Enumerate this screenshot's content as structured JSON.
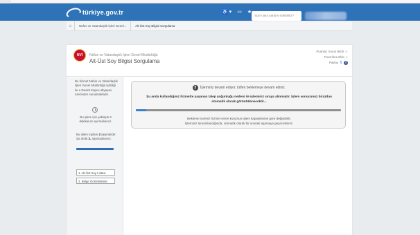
{
  "header": {
    "logo_text": "türkiye.gov.tr",
    "accessibility_label": "♿ ▾",
    "icons": [
      "accessibility-icon",
      "id-card-icon",
      "star-icon"
    ],
    "search_placeholder": "Size nasıl yardım edebiliriz?",
    "brand_color": "#2e72b8"
  },
  "breadcrumb": {
    "items": [
      "Nüfus ve Vatandaşlık İşleri Genel...",
      "Alt-Üst Soy Bilgisi Sorgulama"
    ]
  },
  "service": {
    "logo_text": "NVİ",
    "org": "Nüfus ve Vatandaşlık İşleri Genel Müdürlüğü",
    "title": "Alt-Üst Soy Bilgisi Sorgulama",
    "links": {
      "rate": "Puanla | Sorun Bildir",
      "favorite": "Favorilere Ekle",
      "share": "Paylaş"
    }
  },
  "sidebar": {
    "intro": "Bu hizmet Nüfus ve Vatandaşlık İşleri Genel Müdürlüğü işbirliği ile e-Devlet Kapısı altyapısı üzerinden sunulmaktadır.",
    "time_text": "Bu işlem için yaklaşık 3 dakikanızı ayırmalısınız.",
    "steps_text_prefix": "Bu işlem toplam",
    "steps_total": "2",
    "steps_text_mid": "aşamalıdır.",
    "steps_current_prefix": "Şu anda",
    "steps_current": "2.",
    "steps_current_suffix": "aşamadasınız.",
    "progress": 1.0,
    "step_items": [
      "1. Alt-Üst Soy Listesi",
      "2. Belge Görüntüleme"
    ]
  },
  "wait": {
    "heading": "İşleminiz devam ediyor, lütfen beklemeye devam ediniz.",
    "message": "Şu anda kullandığınız hizmette yaşanan talep yoğunluğu nedeni ile işleminiz sıraya alınmıştır. İşlem sonucunuz birazdan otomatik olarak görüntülenecektir...",
    "progress": 0.05,
    "note_line1": "Bekleme süreniz hizmet veren kurumun işlem kapasitesine göre değişebilir.",
    "note_line2": "İşleminiz tamamlandığında, otomatik olarak bir sonraki aşamaya geçeceksiniz."
  }
}
